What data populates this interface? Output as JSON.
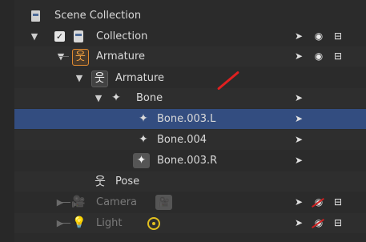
{
  "outliner": {
    "header": {
      "label": "Scene Collection"
    },
    "rows": {
      "collection": {
        "label": "Collection"
      },
      "armature_object": {
        "label": "Armature"
      },
      "armature_data": {
        "label": "Armature"
      },
      "bone": {
        "label": "Bone"
      },
      "bone_003_l": {
        "label": "Bone.003.L"
      },
      "bone_004": {
        "label": "Bone.004"
      },
      "bone_003_r": {
        "label": "Bone.003.R"
      },
      "pose": {
        "label": "Pose"
      },
      "camera": {
        "label": "Camera"
      },
      "light": {
        "label": "Light"
      }
    },
    "glyphs": {
      "expanded": "▼",
      "collapsed": "▶",
      "check": "✓",
      "armature": "🯅",
      "bone": "✦",
      "pose": "🯅",
      "camera": "🎥",
      "cursor": "➤",
      "eye": "◉",
      "camera_toggle": "⊟"
    },
    "colors": {
      "selected_row": "#334d80",
      "armature_orange": "#e08a30",
      "light_yellow": "#e2c01f",
      "disabled_red": "#d02020"
    }
  }
}
